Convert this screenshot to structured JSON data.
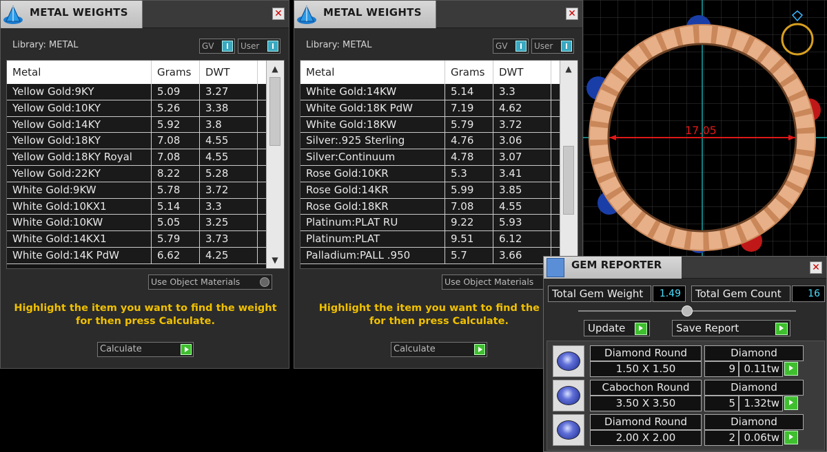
{
  "panels": [
    {
      "title": "METAL WEIGHTS",
      "library_label": "Library: METAL",
      "toggle_gv": "GV",
      "toggle_user": "User",
      "columns": [
        "Metal",
        "Grams",
        "DWT"
      ],
      "rows": [
        [
          "Yellow Gold:9KY",
          "5.09",
          "3.27"
        ],
        [
          "Yellow Gold:10KY",
          "5.26",
          "3.38"
        ],
        [
          "Yellow Gold:14KY",
          "5.92",
          "3.8"
        ],
        [
          "Yellow Gold:18KY",
          "7.08",
          "4.55"
        ],
        [
          "Yellow Gold:18KY Royal",
          "7.08",
          "4.55"
        ],
        [
          "Yellow Gold:22KY",
          "8.22",
          "5.28"
        ],
        [
          "White Gold:9KW",
          "5.78",
          "3.72"
        ],
        [
          "White Gold:10KX1",
          "5.14",
          "3.3"
        ],
        [
          "White Gold:10KW",
          "5.05",
          "3.25"
        ],
        [
          "White Gold:14KX1",
          "5.79",
          "3.73"
        ],
        [
          "White Gold:14K PdW",
          "6.62",
          "4.25"
        ]
      ],
      "use_object_materials": "Use Object Materials",
      "hint_line1": "Highlight the item you want to find the weight",
      "hint_line2": "for then press Calculate.",
      "calculate_label": "Calculate"
    },
    {
      "title": "METAL WEIGHTS",
      "library_label": "Library: METAL",
      "toggle_gv": "GV",
      "toggle_user": "User",
      "columns": [
        "Metal",
        "Grams",
        "DWT"
      ],
      "rows": [
        [
          "White Gold:14KW",
          "5.14",
          "3.3"
        ],
        [
          "White Gold:18K PdW",
          "7.19",
          "4.62"
        ],
        [
          "White Gold:18KW",
          "5.79",
          "3.72"
        ],
        [
          "Silver:.925 Sterling",
          "4.76",
          "3.06"
        ],
        [
          "Silver:Continuum",
          "4.78",
          "3.07"
        ],
        [
          "Rose Gold:10KR",
          "5.3",
          "3.41"
        ],
        [
          "Rose Gold:14KR",
          "5.99",
          "3.85"
        ],
        [
          "Rose Gold:18KR",
          "7.08",
          "4.55"
        ],
        [
          "Platinum:PLAT RU",
          "9.22",
          "5.93"
        ],
        [
          "Platinum:PLAT",
          "9.51",
          "6.12"
        ],
        [
          "Palladium:PALL .950",
          "5.7",
          "3.66"
        ]
      ],
      "use_object_materials": "Use Object Materials",
      "hint_line1": "Highlight the item you want to find the we",
      "hint_line2": "for then press Calculate.",
      "calculate_label": "Calculate"
    }
  ],
  "viewport": {
    "dimension_label": "17.05"
  },
  "gem_reporter": {
    "title": "GEM REPORTER",
    "total_weight_label": "Total Gem Weight",
    "total_weight_value": "1.49",
    "total_count_label": "Total Gem Count",
    "total_count_value": "16",
    "update_label": "Update",
    "save_report_label": "Save Report",
    "gems": [
      {
        "shape": "Diamond Round",
        "size": "1.50 X 1.50",
        "material": "Diamond",
        "count": "9",
        "weight": "0.11tw"
      },
      {
        "shape": "Cabochon Round",
        "size": "3.50 X 3.50",
        "material": "Diamond",
        "count": "5",
        "weight": "1.32tw"
      },
      {
        "shape": "Diamond Round",
        "size": "2.00 X 2.00",
        "material": "Diamond",
        "count": "2",
        "weight": "0.06tw"
      }
    ]
  }
}
